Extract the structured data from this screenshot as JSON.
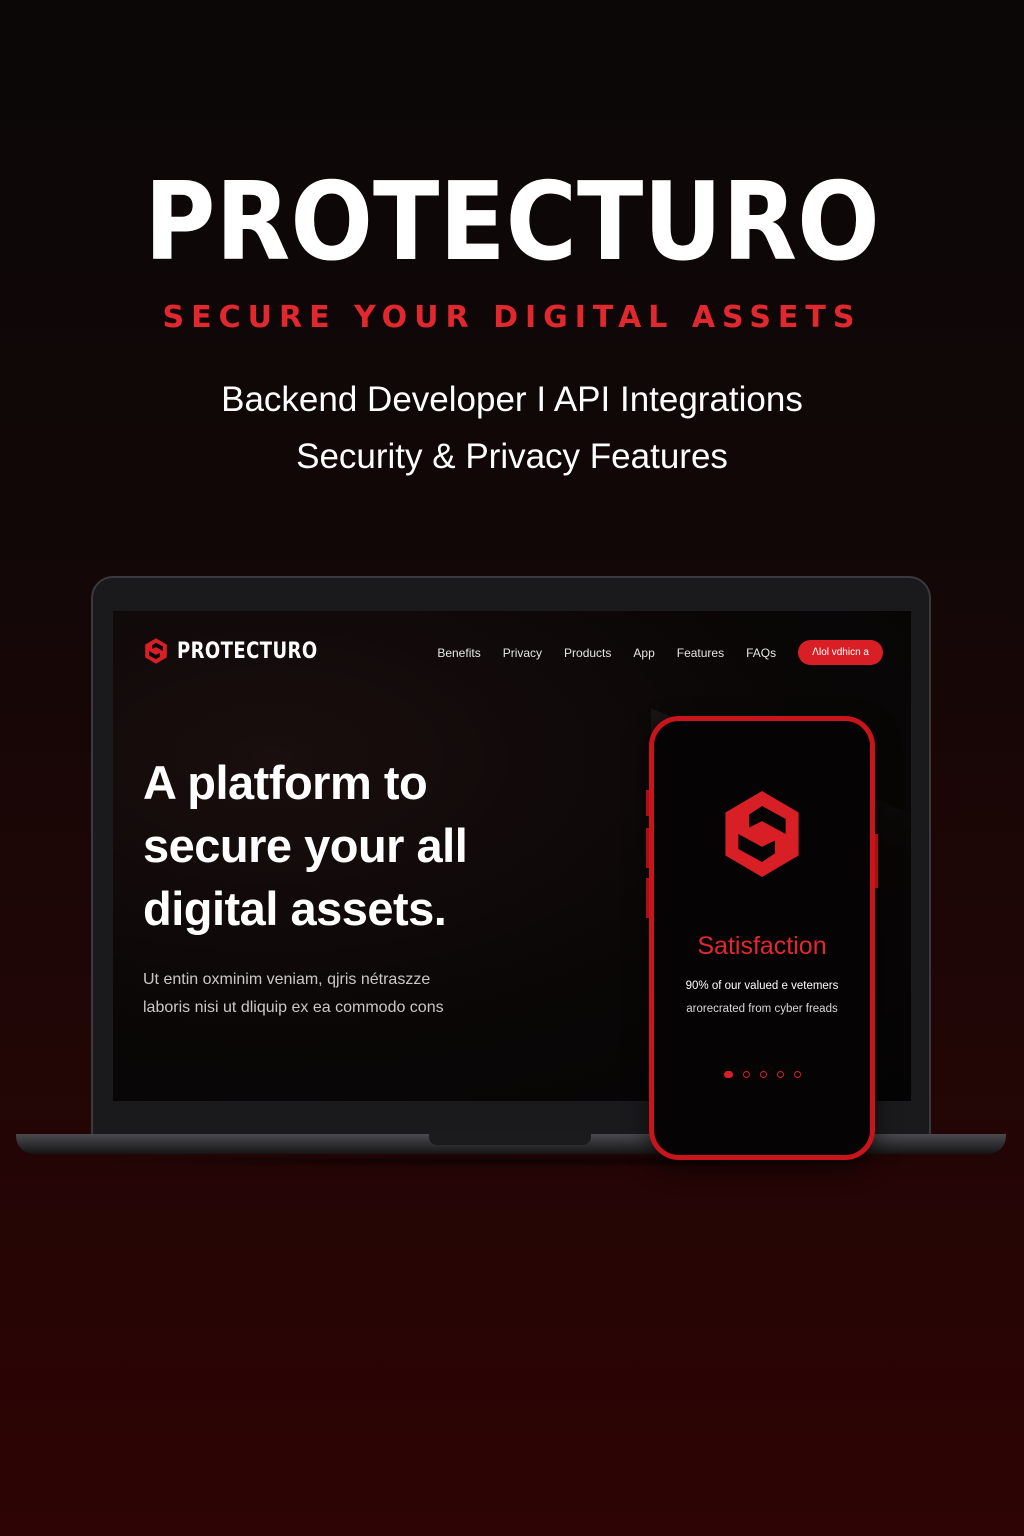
{
  "poster": {
    "title": "PROTECTURO",
    "tagline": "SECURE YOUR DIGITAL ASSETS",
    "role_line1": "Backend Developer I API Integrations",
    "role_line2": "Security & Privacy Features"
  },
  "site": {
    "logo_text": "PROTECTURO",
    "nav": {
      "items": [
        "Benefits",
        "Privacy",
        "Products",
        "App",
        "Features",
        "FAQs"
      ],
      "cta_label": "ꓥlol vdhicn a"
    },
    "hero": {
      "headline_line1": "A platform to",
      "headline_line2": "secure your all",
      "headline_line3": "digital assets.",
      "body_line1": "Ut entin oxminim veniam, qjris nétraszze",
      "body_line2": "laboris nisi ut dliquip ex ea commodo cons"
    }
  },
  "phone": {
    "title": "Satisfaction",
    "subtitle_line1": "90% of our valued e vetemers",
    "subtitle_line2": "arorecrated from cyber freads",
    "slides_total": 5,
    "slide_active": 1
  },
  "colors": {
    "accent": "#d81f26",
    "background": "#0b0707",
    "text": "#ffffff"
  },
  "icons": [
    "shield-logo-icon"
  ]
}
